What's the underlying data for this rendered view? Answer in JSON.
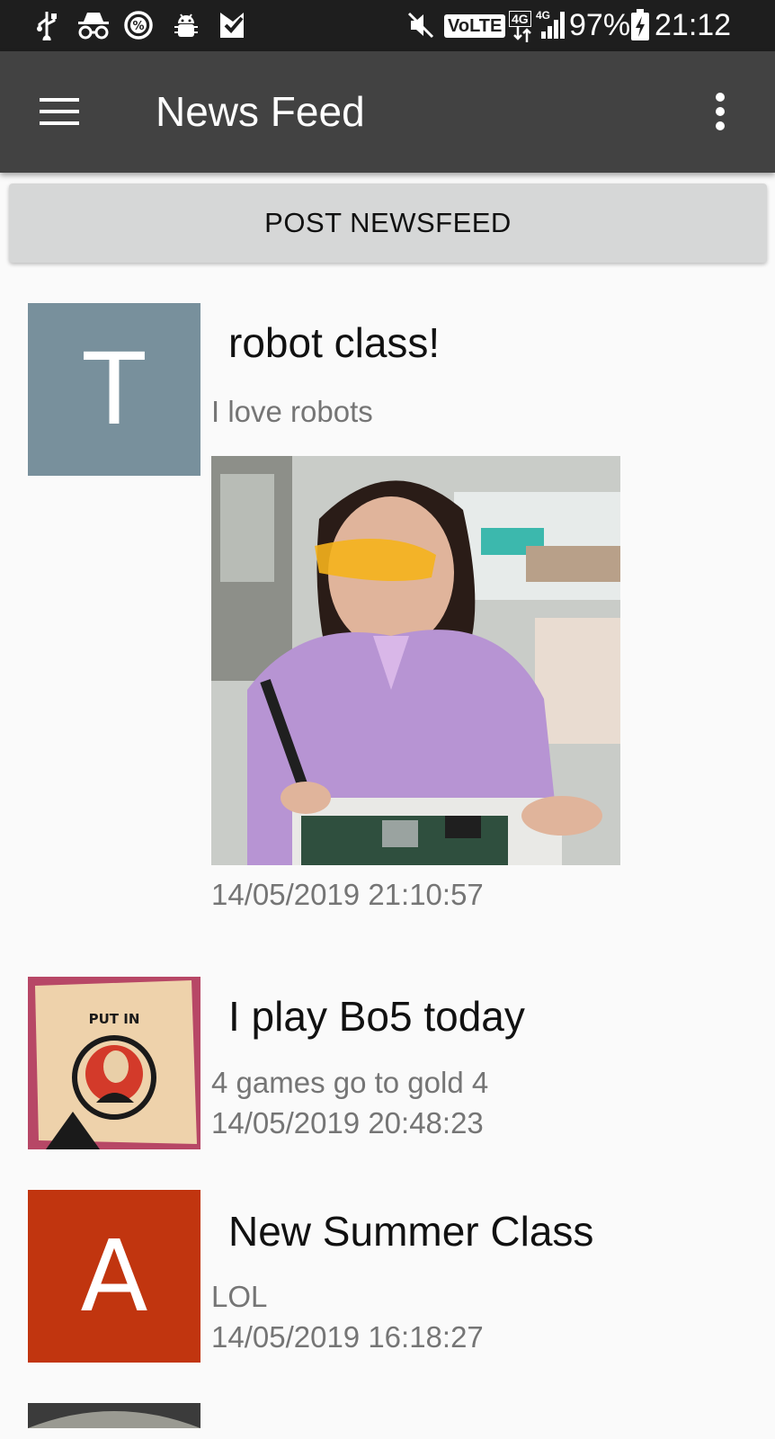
{
  "status_bar": {
    "battery": "97%",
    "time": "21:12",
    "volte": "VoLTE",
    "network_a": "4G",
    "network_b": "4G"
  },
  "app_bar": {
    "title": "News Feed",
    "menu_icon": "hamburger-menu-icon",
    "overflow_icon": "more-vert-icon"
  },
  "post_button": {
    "label": "POST NEWSFEED"
  },
  "colors": {
    "status_bar": "#1e1e1e",
    "app_bar": "#424242",
    "post_button": "#d6d7d7",
    "avatar_t": "#78909c",
    "avatar_a": "#c1350f"
  },
  "feed": [
    {
      "avatar_letter": "T",
      "title": "robot class!",
      "body": "I love robots",
      "image": "woman-soldering-circuit-board-photo",
      "date": "14/05/2019 21:10:57"
    },
    {
      "avatar_image": "put-in-badge-photo",
      "avatar_image_text": "PUT IN",
      "title": "I play Bo5 today",
      "body": "4 games go to gold 4",
      "date": "14/05/2019 20:48:23"
    },
    {
      "avatar_letter": "A",
      "title": "New Summer Class",
      "body": "LOL",
      "date": "14/05/2019 16:18:27"
    }
  ]
}
